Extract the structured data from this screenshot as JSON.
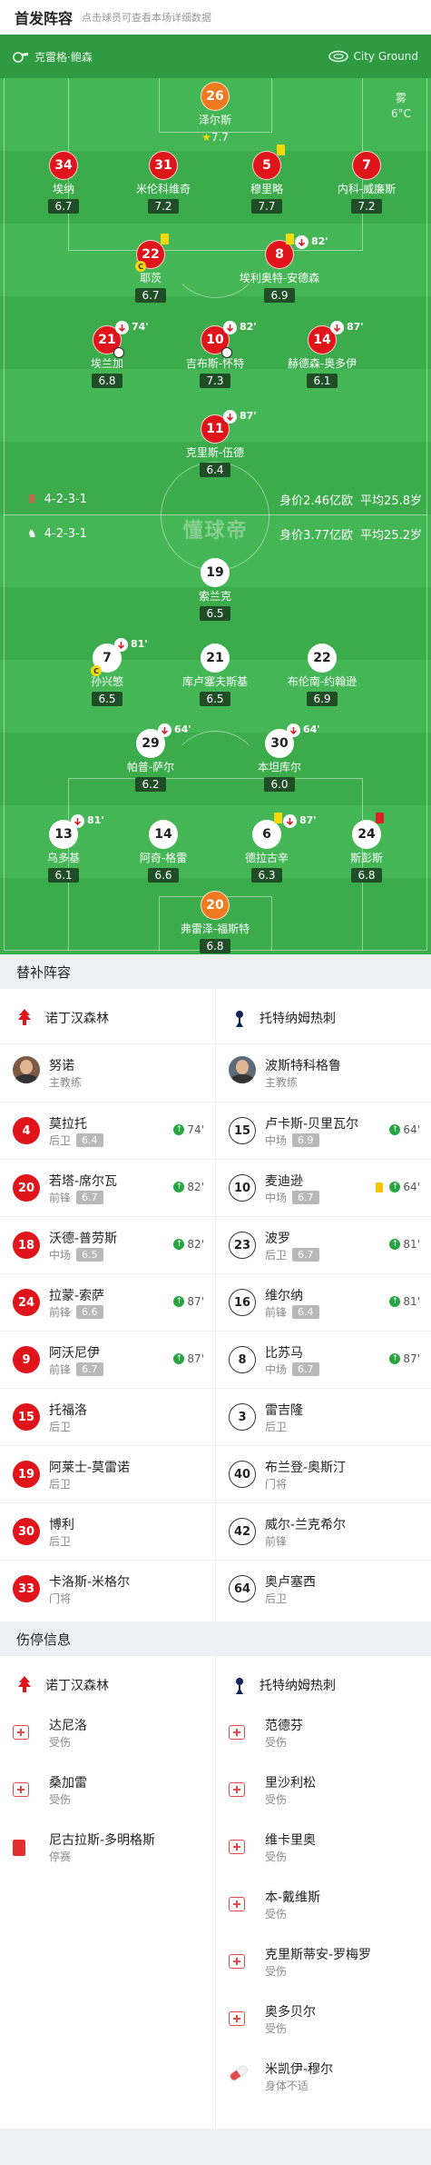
{
  "header": {
    "title": "首发阵容",
    "subtitle": "点击球员可查看本场详细数据"
  },
  "pitch_bar": {
    "home_stadium": "克雷格·鲍森",
    "away_stadium": "City Ground"
  },
  "weather": {
    "condition": "雾",
    "temp": "6°C"
  },
  "watermark": "懂球帝",
  "home_players": [
    {
      "num": "26",
      "name": "泽尔斯",
      "rating": "7.7",
      "star": true
    },
    {
      "num": "34",
      "name": "埃纳",
      "rating": "6.7"
    },
    {
      "num": "31",
      "name": "米伦科维奇",
      "rating": "7.2"
    },
    {
      "num": "5",
      "name": "穆里略",
      "rating": "7.7",
      "card": "yellow"
    },
    {
      "num": "7",
      "name": "内科-威廉斯",
      "rating": "7.2"
    },
    {
      "num": "22",
      "name": "耶茨",
      "rating": "6.7",
      "card": "yellow",
      "captain": "C"
    },
    {
      "num": "8",
      "name": "埃利奥特-安德森",
      "rating": "6.9",
      "card": "yellow",
      "sub": "82'"
    },
    {
      "num": "21",
      "name": "埃兰加",
      "rating": "6.8",
      "sub": "74'",
      "goal": true
    },
    {
      "num": "10",
      "name": "吉布斯-怀特",
      "rating": "7.3",
      "sub": "82'",
      "goal": true
    },
    {
      "num": "14",
      "name": "赫德森-奥多伊",
      "rating": "6.1",
      "sub": "87'"
    },
    {
      "num": "11",
      "name": "克里斯-伍德",
      "rating": "6.4",
      "sub": "87'"
    }
  ],
  "formation_home": {
    "shape": "4-2-3-1",
    "value": "身价2.46亿欧",
    "age": "平均25.8岁"
  },
  "formation_away": {
    "shape": "4-2-3-1",
    "value": "身价3.77亿欧",
    "age": "平均25.2岁"
  },
  "away_players": [
    {
      "num": "19",
      "name": "索兰克",
      "rating": "6.5"
    },
    {
      "num": "7",
      "name": "孙兴慜",
      "rating": "6.5",
      "sub": "81'",
      "captain": "C"
    },
    {
      "num": "21",
      "name": "库卢塞夫斯基",
      "rating": "6.5"
    },
    {
      "num": "22",
      "name": "布伦南-约翰逊",
      "rating": "6.9"
    },
    {
      "num": "29",
      "name": "帕普-萨尔",
      "rating": "6.2",
      "sub": "64'"
    },
    {
      "num": "30",
      "name": "本坦库尔",
      "rating": "6.0",
      "sub": "64'"
    },
    {
      "num": "13",
      "name": "乌多基",
      "rating": "6.1",
      "sub": "81'"
    },
    {
      "num": "14",
      "name": "阿奇-格雷",
      "rating": "6.6"
    },
    {
      "num": "6",
      "name": "德拉古辛",
      "rating": "6.3",
      "card": "yellow",
      "sub": "87'"
    },
    {
      "num": "24",
      "name": "斯彭斯",
      "rating": "6.8",
      "card": "red"
    },
    {
      "num": "20",
      "name": "弗雷泽-福斯特",
      "rating": "6.8"
    }
  ],
  "subs_section": {
    "title": "替补阵容"
  },
  "teams": {
    "home": "诺丁汉森林",
    "away": "托特纳姆热刺"
  },
  "coaches": {
    "home": {
      "name": "努诺",
      "role": "主教练"
    },
    "away": {
      "name": "波斯特科格鲁",
      "role": "主教练"
    }
  },
  "subs_home": [
    {
      "num": "4",
      "name": "莫拉托",
      "pos": "后卫",
      "rating": "6.4",
      "time": "74'"
    },
    {
      "num": "20",
      "name": "若塔-席尔瓦",
      "pos": "前锋",
      "rating": "6.7",
      "time": "82'"
    },
    {
      "num": "18",
      "name": "沃德-普劳斯",
      "pos": "中场",
      "rating": "6.5",
      "time": "82'"
    },
    {
      "num": "24",
      "name": "拉蒙-索萨",
      "pos": "前锋",
      "rating": "6.6",
      "time": "87'"
    },
    {
      "num": "9",
      "name": "阿沃尼伊",
      "pos": "前锋",
      "rating": "6.7",
      "time": "87'"
    },
    {
      "num": "15",
      "name": "托福洛",
      "pos": "后卫"
    },
    {
      "num": "19",
      "name": "阿莱士-莫雷诺",
      "pos": "后卫"
    },
    {
      "num": "30",
      "name": "博利",
      "pos": "后卫"
    },
    {
      "num": "33",
      "name": "卡洛斯-米格尔",
      "pos": "门将"
    }
  ],
  "subs_away": [
    {
      "num": "15",
      "name": "卢卡斯-贝里瓦尔",
      "pos": "中场",
      "rating": "6.9",
      "time": "64'"
    },
    {
      "num": "10",
      "name": "麦迪逊",
      "pos": "中场",
      "rating": "6.7",
      "time": "64'",
      "card": "yellow"
    },
    {
      "num": "23",
      "name": "波罗",
      "pos": "后卫",
      "rating": "6.7",
      "time": "81'"
    },
    {
      "num": "16",
      "name": "维尔纳",
      "pos": "前锋",
      "rating": "6.4",
      "time": "81'"
    },
    {
      "num": "8",
      "name": "比苏马",
      "pos": "中场",
      "rating": "6.7",
      "time": "87'"
    },
    {
      "num": "3",
      "name": "雷吉隆",
      "pos": "后卫"
    },
    {
      "num": "40",
      "name": "布兰登-奥斯汀",
      "pos": "门将"
    },
    {
      "num": "42",
      "name": "威尔-兰克希尔",
      "pos": "前锋"
    },
    {
      "num": "64",
      "name": "奥卢塞西",
      "pos": "后卫"
    }
  ],
  "injury_section": {
    "title": "伤停信息"
  },
  "injuries_home": [
    {
      "name": "达尼洛",
      "status": "受伤",
      "icon": "medkit-icon"
    },
    {
      "name": "桑加雷",
      "status": "受伤",
      "icon": "medkit-icon"
    },
    {
      "name": "尼古拉斯-多明格斯",
      "status": "停赛",
      "icon": "red-card-icon"
    }
  ],
  "injuries_away": [
    {
      "name": "范德芬",
      "status": "受伤",
      "icon": "medkit-icon"
    },
    {
      "name": "里沙利松",
      "status": "受伤",
      "icon": "medkit-icon"
    },
    {
      "name": "维卡里奥",
      "status": "受伤",
      "icon": "medkit-icon"
    },
    {
      "name": "本-戴维斯",
      "status": "受伤",
      "icon": "medkit-icon"
    },
    {
      "name": "克里斯蒂安-罗梅罗",
      "status": "受伤",
      "icon": "medkit-icon"
    },
    {
      "name": "奥多贝尔",
      "status": "受伤",
      "icon": "medkit-icon"
    },
    {
      "name": "米凯伊-穆尔",
      "status": "身体不适",
      "icon": "pill-icon"
    }
  ]
}
